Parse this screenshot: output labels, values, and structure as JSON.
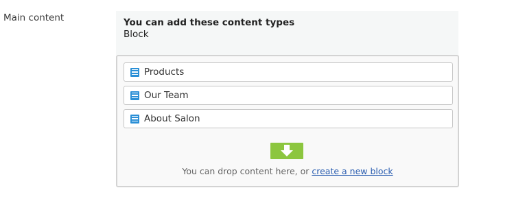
{
  "field": {
    "label": "Main content"
  },
  "info": {
    "title": "You can add these content types",
    "types": "Block"
  },
  "blocks": [
    {
      "label": "Products",
      "icon": "block-icon"
    },
    {
      "label": "Our Team",
      "icon": "block-icon"
    },
    {
      "label": "About Salon",
      "icon": "block-icon"
    }
  ],
  "dropzone": {
    "icon": "arrow-down-icon",
    "text": "You can drop content here, or ",
    "link_label": "create a new block"
  },
  "colors": {
    "block_icon": "#2a8fd6",
    "drop_icon": "#8cc63f",
    "link": "#2a5db0"
  }
}
